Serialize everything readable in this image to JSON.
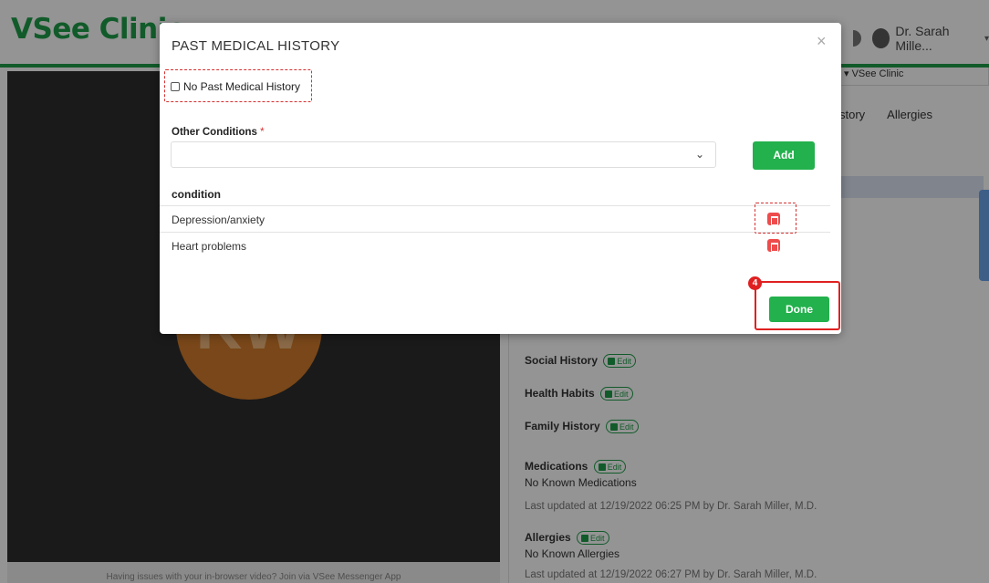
{
  "app": {
    "logo_text": "VSee Clinic",
    "user_name": "Dr. Sarah Mille...",
    "clinic_selector": "VSee Clinic",
    "brand_color": "#1e9e49"
  },
  "tabs": [
    "story",
    "Allergies"
  ],
  "video": {
    "avatar_initials": "KW",
    "footer_text": "Having issues with your in-browser video? Join via VSee Messenger App"
  },
  "summary": {
    "edit_label": "Edit",
    "social_history": "Social History",
    "health_habits": "Health Habits",
    "family_history": "Family History",
    "medications": "Medications",
    "medications_value": "No Known Medications",
    "medications_updated": "Last updated at 12/19/2022 06:25 PM by Dr. Sarah Miller, M.D.",
    "allergies": "Allergies",
    "allergies_value": "No Known Allergies",
    "allergies_updated": "Last updated at 12/19/2022 06:27 PM by Dr. Sarah Miller, M.D."
  },
  "modal": {
    "title": "PAST MEDICAL HISTORY",
    "close_symbol": "×",
    "no_history_label": "No Past Medical History",
    "no_history_checked": false,
    "other_conditions_label": "Other Conditions",
    "required_mark": "*",
    "select_value": "",
    "add_label": "Add",
    "table_header": "condition",
    "conditions": [
      "Depression/anxiety",
      "Heart problems"
    ],
    "done_label": "Done",
    "step_number": "4"
  },
  "colors": {
    "button_green": "#22b14c",
    "delete_red": "#ee4c4c",
    "highlight_red": "#e02020"
  }
}
